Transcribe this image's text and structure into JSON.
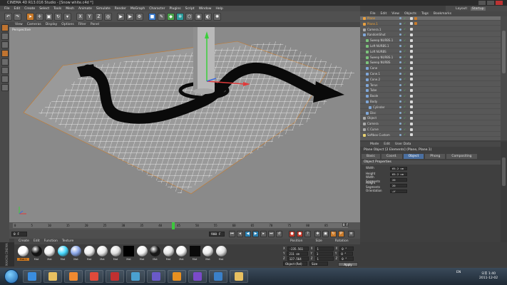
{
  "window": {
    "title": "CINEMA 4D R13.016 Studio - [Snow white.c4d *]"
  },
  "menubar": [
    "File",
    "Edit",
    "Create",
    "Select",
    "Tools",
    "Mesh",
    "Animate",
    "Simulate",
    "Render",
    "MoGraph",
    "Character",
    "Plugins",
    "Script",
    "Window",
    "Help"
  ],
  "layoutbar": {
    "label": "Layout:",
    "value": "Startup"
  },
  "viewport": {
    "menu": [
      "View",
      "Cameras",
      "Display",
      "Options",
      "Filter",
      "Panel"
    ],
    "label": "Perspective"
  },
  "timeline": {
    "ticks": [
      "0",
      "5",
      "10",
      "15",
      "20",
      "25",
      "30",
      "35",
      "40",
      "45",
      "50",
      "55",
      "60",
      "65",
      "70",
      "75",
      "80",
      "85",
      "90"
    ],
    "end_label": "0 F",
    "start_field": "0 F",
    "end_field": "900 F",
    "frame_field": "-0 F"
  },
  "material_manager": {
    "menu": [
      "Create",
      "Edit",
      "Function",
      "Texture"
    ],
    "materials": [
      {
        "name": "Mat.1",
        "color": "#ffffff",
        "selected": true
      },
      {
        "name": "Mat",
        "color": "#111111"
      },
      {
        "name": "Mat",
        "color": "#f0f0f0"
      },
      {
        "name": "Mat",
        "color": "#46d9ff"
      },
      {
        "name": "Mat",
        "color": "#8aa6e8"
      },
      {
        "name": "Mat",
        "color": "#eeeeee"
      },
      {
        "name": "Mat",
        "color": "#e8e8e8"
      },
      {
        "name": "Mat",
        "color": "#dddddd"
      },
      {
        "name": "Mat",
        "color": "#000000",
        "square": true
      },
      {
        "name": "Mat",
        "color": "#f2f2f2"
      },
      {
        "name": "Mat",
        "color": "#181818"
      },
      {
        "name": "Mat",
        "color": "#e4e4e4"
      },
      {
        "name": "Mat",
        "color": "#f6f6f6"
      },
      {
        "name": "Mat",
        "color": "#0a0a0a",
        "square": true
      },
      {
        "name": "Mat",
        "color": "#eaeaea"
      },
      {
        "name": "Mat",
        "color": "#e0e0e0"
      }
    ]
  },
  "coordinates": {
    "headers": [
      "Position",
      "Size",
      "Rotation"
    ],
    "rows": [
      {
        "axis": "X",
        "pos": "-235.561 cm",
        "size": "1",
        "rotation": "0 °"
      },
      {
        "axis": "Y",
        "pos": "211 cm",
        "size": "1",
        "rotation": "0 °"
      },
      {
        "axis": "Z",
        "pos": "127.564 cm",
        "size": "1",
        "rotation": "0 °"
      }
    ],
    "mode": "Object (Rel)",
    "size_mode": "Size",
    "apply_label": "Apply"
  },
  "objects_manager": {
    "menu": [
      "File",
      "Edit",
      "View",
      "Objects",
      "Tags",
      "Bookmarks"
    ],
    "rows": [
      {
        "name": "Plane",
        "indent": 0,
        "selected": true,
        "highlight": true,
        "icon": "#e8a040"
      },
      {
        "name": "Plane.1",
        "indent": 0,
        "highlight": true,
        "icon": "#e8a040"
      },
      {
        "name": "Camera.1",
        "indent": 0,
        "icon": "#aaaaaa"
      },
      {
        "name": "RandomShut",
        "indent": 0,
        "icon": "#7fa7d9"
      },
      {
        "name": "Sweep NURBS.1",
        "indent": 1,
        "icon": "#7cc47c"
      },
      {
        "name": "Loft NURBS.1",
        "indent": 1,
        "icon": "#7cc47c"
      },
      {
        "name": "Loft NURBS",
        "indent": 1,
        "icon": "#7cc47c"
      },
      {
        "name": "Sweep NURBS.1",
        "indent": 1,
        "icon": "#7cc47c"
      },
      {
        "name": "Sweep NURBS",
        "indent": 1,
        "icon": "#7cc47c"
      },
      {
        "name": "Cone",
        "indent": 1,
        "icon": "#7fa7d9"
      },
      {
        "name": "Cone.1",
        "indent": 1,
        "icon": "#7fa7d9"
      },
      {
        "name": "Cone.2",
        "indent": 1,
        "icon": "#7fa7d9"
      },
      {
        "name": "Torus",
        "indent": 1,
        "icon": "#7fa7d9"
      },
      {
        "name": "Tube",
        "indent": 1,
        "icon": "#7fa7d9"
      },
      {
        "name": "Boole",
        "indent": 1,
        "icon": "#7fa7d9"
      },
      {
        "name": "Body",
        "indent": 1,
        "icon": "#7fa7d9"
      },
      {
        "name": "Cylinder",
        "indent": 2,
        "icon": "#7fa7d9"
      },
      {
        "name": "Disc",
        "indent": 1,
        "icon": "#7fa7d9"
      },
      {
        "name": "Object",
        "indent": 0,
        "icon": "#aaaaaa"
      },
      {
        "name": "Camera",
        "indent": 0,
        "icon": "#aaaaaa"
      },
      {
        "name": "C Curve",
        "indent": 0,
        "icon": "#aaaaaa"
      },
      {
        "name": "Softbox Custom",
        "indent": 0,
        "icon": "#e6d070"
      }
    ]
  },
  "attribute_manager": {
    "menu": [
      "Mode",
      "Edit",
      "User Data"
    ],
    "title": "Plane Object [2 Elements] (Plane, Plane.1)",
    "tabs": [
      {
        "label": "Basic"
      },
      {
        "label": "Coord."
      },
      {
        "label": "Object",
        "selected": true
      },
      {
        "label": "Phong"
      },
      {
        "label": "Compositing"
      }
    ],
    "section": "Object Properties",
    "properties": [
      {
        "label": "Width",
        "value": "65.2 cm"
      },
      {
        "label": "Height",
        "value": "65.2 cm"
      },
      {
        "label": "Width Segments",
        "value": "20"
      },
      {
        "label": "Height Segments",
        "value": "20"
      },
      {
        "label": "Orientation",
        "value": "+Y"
      }
    ]
  },
  "taskbar": {
    "apps": [
      {
        "name": "internet-explorer",
        "color": "#3a8de0"
      },
      {
        "name": "file-explorer",
        "color": "#e8c060"
      },
      {
        "name": "media-player",
        "color": "#f08a30"
      },
      {
        "name": "chrome",
        "color": "#e04a3a"
      },
      {
        "name": "adobe-acrobat",
        "color": "#c03030"
      },
      {
        "name": "cinema-4d",
        "color": "#4aa0d0"
      },
      {
        "name": "after-effects",
        "color": "#6a5ac8"
      },
      {
        "name": "illustrator",
        "color": "#e89020"
      },
      {
        "name": "premiere",
        "color": "#7a4ac8"
      },
      {
        "name": "photoshop",
        "color": "#3a80c8"
      },
      {
        "name": "folder",
        "color": "#e8c060"
      }
    ],
    "tray": "EN",
    "time": "오후 1:40",
    "date": "2011-12-02"
  },
  "colors": {
    "accent": "#d07a20",
    "selection_blue": "#4a6fa0",
    "timeline_marker": "#3cc83c"
  }
}
